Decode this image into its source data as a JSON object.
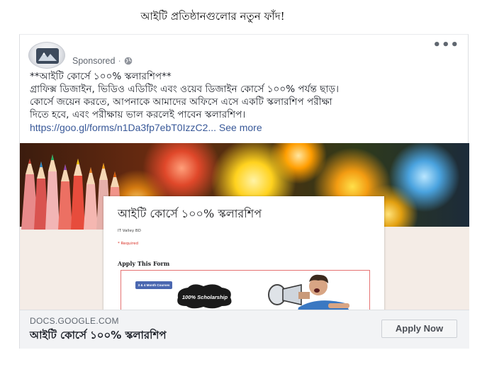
{
  "headline": "আইটি প্রতিষ্ঠানগুলোর নতুন ফাঁদ!",
  "post": {
    "sponsored_label": "Sponsored",
    "separator": "·",
    "avatar_icon": "page-logo-mountain-icon",
    "more_icon": "more-options-icon",
    "text_lines": [
      "**আইটি কোর্সে ১০০% স্কলারশিপ**",
      "গ্রাফিক্স ডিজাইন, ভিডিও এডিটিং এবং ওয়েব ডিজাইন কোর্সে ১০০% পর্যন্ত ছাড়।",
      "কোর্সে জয়েন করতে, আপনাকে আমাদের অফিসে এসে একটি স্কলারশিপ পরীক্ষা",
      "দিতে হবে, এবং পরীক্ষায় ভাল করলেই পাবেন স্কলারশিপ।"
    ],
    "link_text": "https://goo.gl/forms/n1Da3fp7ebT0IzzC2...",
    "see_more": "See more"
  },
  "banner": {
    "form_title": "আইটি কোর্সে ১০০% স্কলারশিপ",
    "form_org": "IT Valley BD",
    "form_required": "* Required",
    "form_section": "Apply This Form",
    "course_badge": "3 & 4 Month Courses",
    "scholarship_text": "100% Scholarship"
  },
  "footer": {
    "domain": "DOCS.GOOGLE.COM",
    "title": "আইটি কোর্সে ১০০% স্কলারশিপ",
    "cta_label": "Apply Now"
  },
  "colors": {
    "link": "#385898",
    "footer_bg": "#f2f3f5",
    "secondary_text": "#616770"
  }
}
